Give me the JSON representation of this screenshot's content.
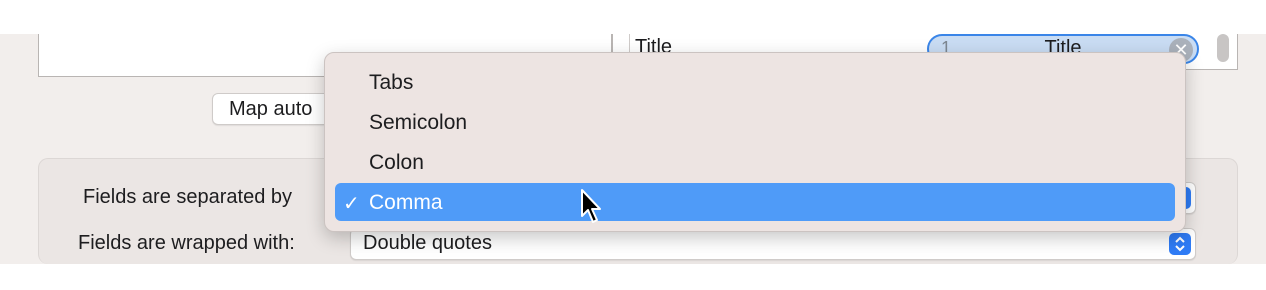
{
  "mapping_table": {
    "row_label": "Title",
    "token": {
      "index": "1",
      "title": "Title"
    }
  },
  "map_button_label": "Map auto",
  "options": {
    "separator_label": "Fields are separated by",
    "wrapper_label": "Fields are wrapped with:",
    "wrapper_value": "Double quotes"
  },
  "dropdown": {
    "items": [
      {
        "label": "Tabs"
      },
      {
        "label": "Semicolon"
      },
      {
        "label": "Colon"
      },
      {
        "label": "Comma",
        "selected": true
      }
    ],
    "checkmark": "✓"
  },
  "colors": {
    "accent": "#2f7cf6",
    "menu_highlight": "#4f9bf8",
    "token_fill": "#c9dcf3"
  },
  "icons": [
    "clear-token-icon",
    "popup-stepper-icon",
    "checkmark-icon",
    "mouse-pointer-icon"
  ]
}
